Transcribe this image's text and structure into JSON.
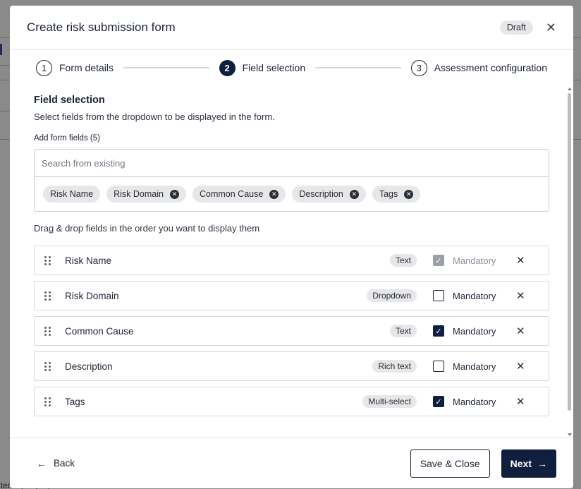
{
  "background": {
    "footer_text": "items per page"
  },
  "modal": {
    "title": "Create risk submission form",
    "status_badge": "Draft",
    "close_icon": "close-icon"
  },
  "stepper": {
    "steps": [
      {
        "number": "1",
        "label": "Form details",
        "active": false
      },
      {
        "number": "2",
        "label": "Field selection",
        "active": true
      },
      {
        "number": "3",
        "label": "Assessment configuration",
        "active": false
      }
    ]
  },
  "section": {
    "title": "Field selection",
    "description": "Select fields from the dropdown to be displayed in the form.",
    "add_label": "Add form fields (5)",
    "search_placeholder": "Search from existing",
    "chips": [
      "Risk Name",
      "Risk Domain",
      "Common Cause",
      "Description",
      "Tags"
    ],
    "drag_hint": "Drag & drop fields in the order you want to display them"
  },
  "fields": [
    {
      "name": "Risk Name",
      "type": "Text",
      "mandatory": true,
      "locked": true,
      "mandatory_label": "Mandatory"
    },
    {
      "name": "Risk Domain",
      "type": "Dropdown",
      "mandatory": false,
      "locked": false,
      "mandatory_label": "Mandatory"
    },
    {
      "name": "Common Cause",
      "type": "Text",
      "mandatory": true,
      "locked": false,
      "mandatory_label": "Mandatory"
    },
    {
      "name": "Description",
      "type": "Rich text",
      "mandatory": false,
      "locked": false,
      "mandatory_label": "Mandatory"
    },
    {
      "name": "Tags",
      "type": "Multi-select",
      "mandatory": true,
      "locked": false,
      "mandatory_label": "Mandatory"
    }
  ],
  "footer": {
    "back_label": "Back",
    "save_close_label": "Save & Close",
    "next_label": "Next"
  },
  "colors": {
    "primary": "#0f1f3d",
    "badge_bg": "#e6e7e9",
    "border": "#d5d8dc"
  }
}
